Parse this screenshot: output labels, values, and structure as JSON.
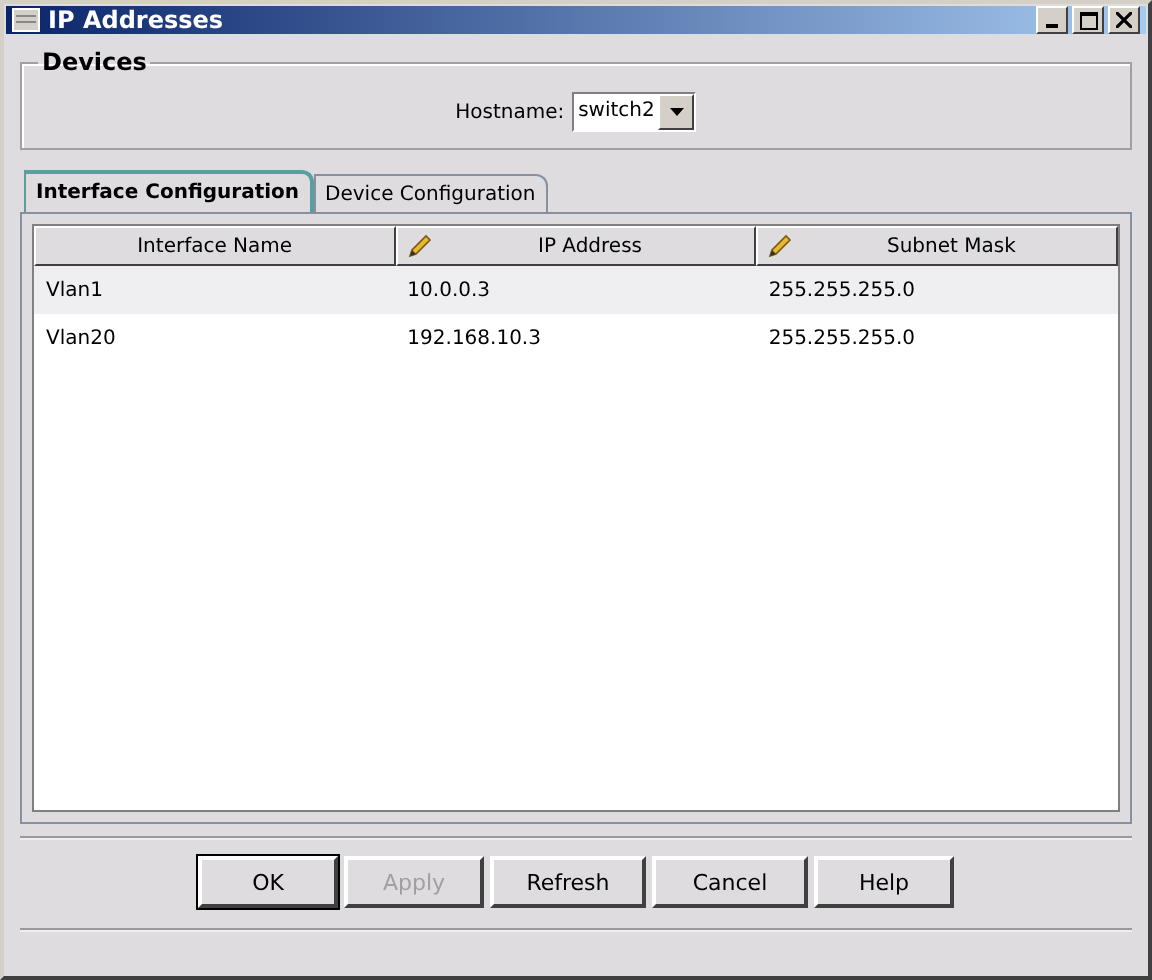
{
  "window": {
    "title": "IP Addresses"
  },
  "devices": {
    "title": "Devices",
    "hostname_label": "Hostname:",
    "hostname_value": "switch2"
  },
  "tabs": [
    {
      "label": "Interface Configuration",
      "selected": true
    },
    {
      "label": "Device Configuration",
      "selected": false
    }
  ],
  "table": {
    "columns": [
      {
        "label": "Interface Name",
        "editable": false
      },
      {
        "label": "IP Address",
        "editable": true
      },
      {
        "label": "Subnet Mask",
        "editable": true
      }
    ],
    "rows": [
      [
        "Vlan1",
        "10.0.0.3",
        "255.255.255.0"
      ],
      [
        "Vlan20",
        "192.168.10.3",
        "255.255.255.0"
      ]
    ]
  },
  "buttons": [
    {
      "label": "OK",
      "disabled": false,
      "default": true
    },
    {
      "label": "Apply",
      "disabled": true,
      "default": false
    },
    {
      "label": "Refresh",
      "disabled": false,
      "default": false
    },
    {
      "label": "Cancel",
      "disabled": false,
      "default": false
    },
    {
      "label": "Help",
      "disabled": false,
      "default": false
    }
  ]
}
